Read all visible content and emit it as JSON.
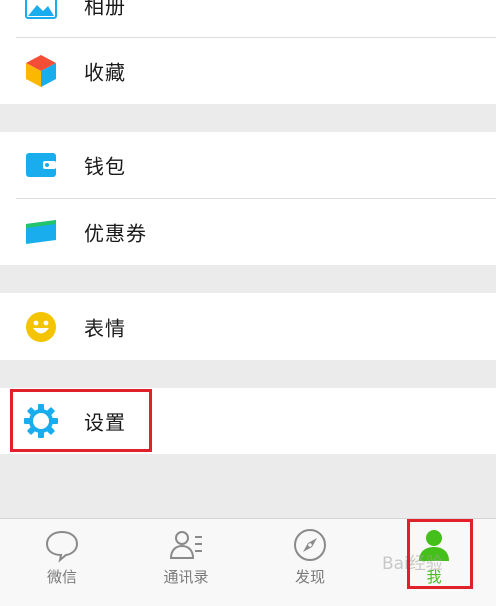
{
  "menu": {
    "album": {
      "label": "相册",
      "icon": "album-icon"
    },
    "favorites": {
      "label": "收藏",
      "icon": "favorites-cube-icon"
    },
    "wallet": {
      "label": "钱包",
      "icon": "wallet-icon"
    },
    "coupons": {
      "label": "优惠券",
      "icon": "coupon-card-icon"
    },
    "stickers": {
      "label": "表情",
      "icon": "smiley-face-icon"
    },
    "settings": {
      "label": "设置",
      "icon": "gear-icon"
    }
  },
  "tabbar": {
    "tabs": [
      {
        "label": "微信",
        "icon": "chat-bubble-icon",
        "active": false
      },
      {
        "label": "通讯录",
        "icon": "contacts-icon",
        "active": false
      },
      {
        "label": "发现",
        "icon": "compass-icon",
        "active": false
      },
      {
        "label": "我",
        "icon": "person-icon",
        "active": true
      }
    ]
  },
  "watermark": "Bai经验",
  "colors": {
    "accent_green": "#45c01a",
    "highlight_red": "#e0202a",
    "icon_blue": "#1aadee",
    "smiley_yellow": "#f5c400"
  }
}
